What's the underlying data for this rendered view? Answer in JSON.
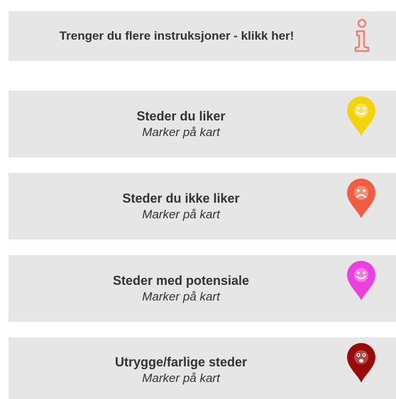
{
  "info": {
    "label": "Trenger du flere instruksjoner - klikk her!",
    "icon": "info-icon",
    "icon_color": "#f08070"
  },
  "categories": [
    {
      "title": "Steder du liker",
      "subtitle": "Marker på kart",
      "icon": "happy-pin-icon",
      "color": "#f2d40c",
      "face": "smile"
    },
    {
      "title": "Steder du ikke liker",
      "subtitle": "Marker på kart",
      "icon": "sad-pin-icon",
      "color": "#f25c42",
      "face": "frown"
    },
    {
      "title": "Steder med potensiale",
      "subtitle": "Marker på kart",
      "icon": "potential-pin-icon",
      "color": "#ec3fe0",
      "face": "smile"
    },
    {
      "title": "Utrygge/farlige steder",
      "subtitle": "Marker på kart",
      "icon": "danger-pin-icon",
      "color": "#9b0a0a",
      "face": "shock"
    }
  ]
}
